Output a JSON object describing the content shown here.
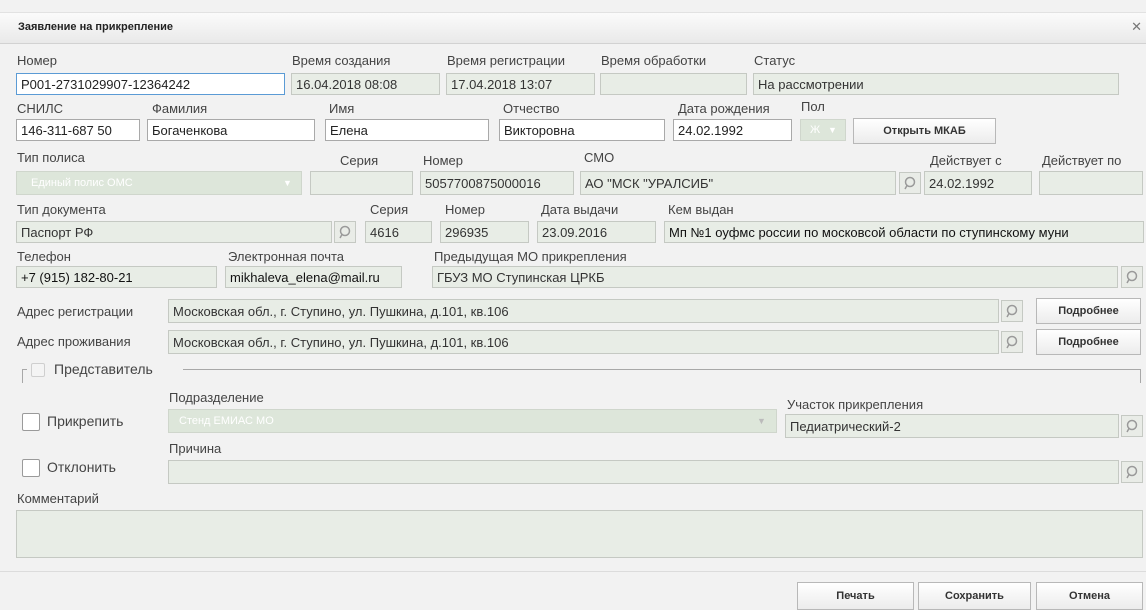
{
  "window": {
    "title": "Заявление на прикрепление",
    "close_icon": "close-icon"
  },
  "labels": {
    "number": "Номер",
    "created": "Время создания",
    "registered": "Время регистрации",
    "processed": "Время обработки",
    "status": "Статус",
    "snils": "СНИЛС",
    "lastname": "Фамилия",
    "firstname": "Имя",
    "middlename": "Отчество",
    "birthdate": "Дата рождения",
    "sex": "Пол",
    "policy_type": "Тип полиса",
    "policy_series": "Серия",
    "policy_number": "Номер",
    "smo": "СМО",
    "valid_from": "Действует с",
    "valid_to": "Действует по",
    "doc_type": "Тип документа",
    "doc_series": "Серия",
    "doc_number": "Номер",
    "issue_date": "Дата выдачи",
    "issued_by": "Кем выдан",
    "phone": "Телефон",
    "email": "Электронная почта",
    "prev_mo": "Предыдущая МО прикрепления",
    "reg_address": "Адрес регистрации",
    "live_address": "Адрес проживания",
    "representative": "Представитель",
    "department": "Подразделение",
    "attach": "Прикрепить",
    "area": "Участок прикрепления",
    "reason": "Причина",
    "reject": "Отклонить",
    "comment": "Комментарий"
  },
  "values": {
    "number": "P001-2731029907-12364242",
    "created": "16.04.2018 08:08",
    "registered": "17.04.2018 13:07",
    "processed": "",
    "status": "На рассмотрении",
    "snils": "146-311-687 50",
    "lastname": "Богаченкова",
    "firstname": "Елена",
    "middlename": "Викторовна",
    "birthdate": "24.02.1992",
    "sex": "Ж",
    "policy_type": "Единый полис ОМС",
    "policy_series": "",
    "policy_number": "5057700875000016",
    "smo": "АО \"МСК \"УРАЛСИБ\"",
    "valid_from": "24.02.1992",
    "valid_to": "",
    "doc_type": "Паспорт РФ",
    "doc_series": "4616",
    "doc_number": "296935",
    "issue_date": "23.09.2016",
    "issued_by": "Мп №1 оуфмс россии по московсой области по ступинскому муни",
    "phone": "+7 (915) 182-80-21",
    "email": "mikhaleva_elena@mail.ru",
    "prev_mo": "ГБУЗ МО Ступинская ЦРКБ",
    "reg_address": "Московская обл., г. Ступино, ул. Пушкина, д.101, кв.106",
    "live_address": "Московская обл., г. Ступино, ул. Пушкина, д.101, кв.106",
    "department": "Стенд ЕМИАС МО",
    "area": "Педиатрический-2",
    "reason": "",
    "comment": ""
  },
  "buttons": {
    "open_mkab": "Открыть МКАБ",
    "details": "Подробнее",
    "print": "Печать",
    "save": "Сохранить",
    "cancel": "Отмена"
  },
  "colors": {
    "readonly_bg": "#e8ede6",
    "disabled_bg": "#dde6da",
    "focus_border": "#5b9bd5"
  }
}
